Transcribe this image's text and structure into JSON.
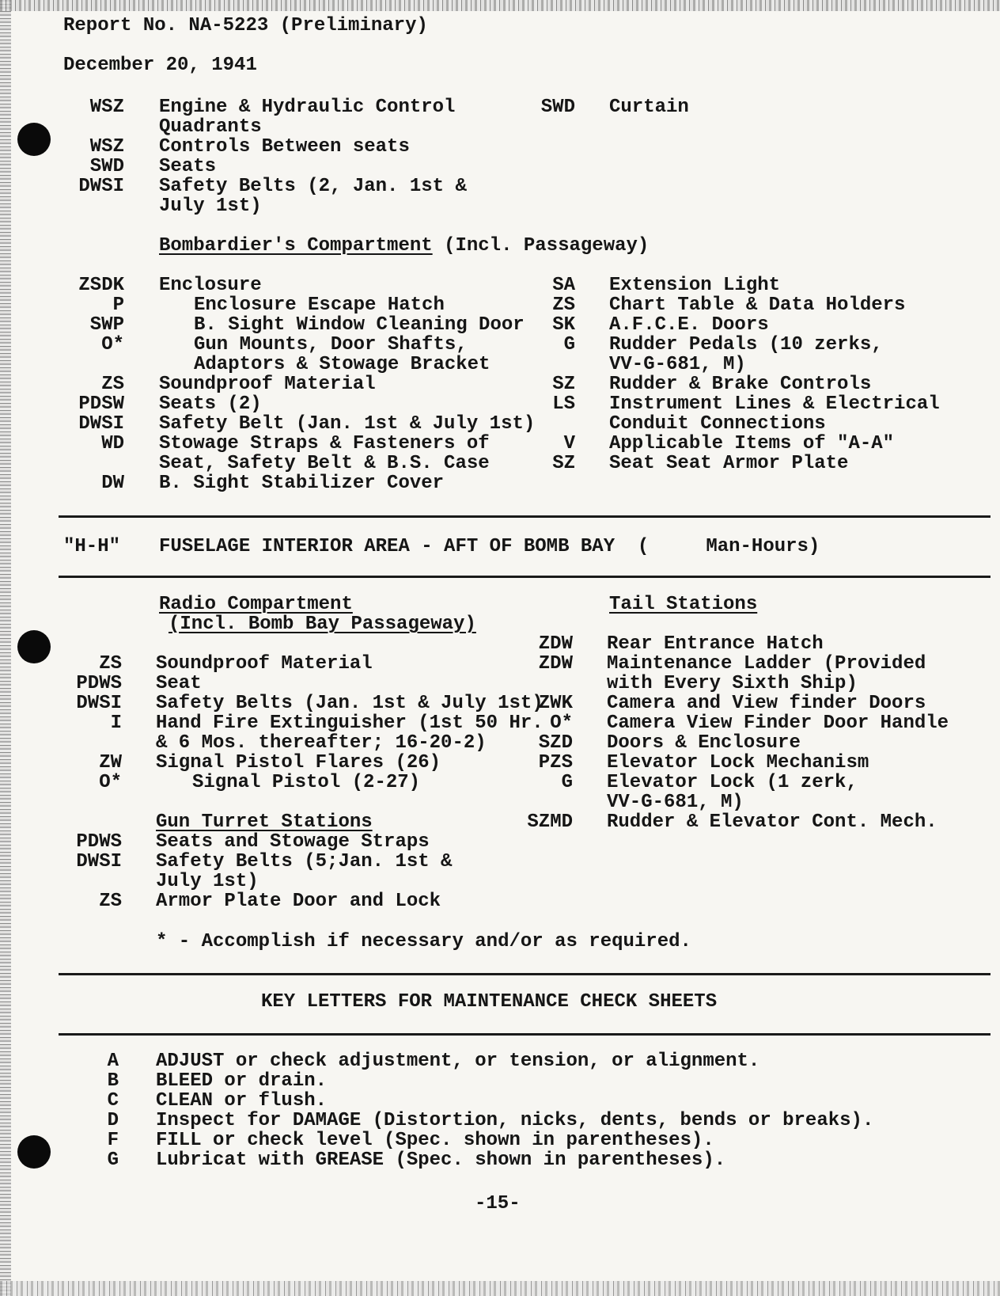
{
  "header": {
    "report_no": "Report No. NA-5223 (Preliminary)",
    "date": "December 20, 1941"
  },
  "pilot_items_left": [
    {
      "code": "WSZ",
      "lines": [
        "Engine & Hydraulic Control",
        "Quadrants"
      ]
    },
    {
      "code": "WSZ",
      "lines": [
        "Controls Between seats"
      ]
    },
    {
      "code": "SWD",
      "lines": [
        "Seats"
      ]
    },
    {
      "code": "DWSI",
      "lines": [
        "Safety Belts (2, Jan. 1st &",
        "July 1st)"
      ]
    }
  ],
  "pilot_items_right": [
    {
      "code": "SWD",
      "lines": [
        "Curtain"
      ]
    }
  ],
  "bombardier": {
    "title": "Bombardier's Compartment",
    "subtitle": "(Incl. Passageway)",
    "left": [
      {
        "code": "ZSDK",
        "text": "Enclosure",
        "indent": false
      },
      {
        "code": "P",
        "text": "Enclosure Escape Hatch",
        "indent": true
      },
      {
        "code": "SWP",
        "text": "B. Sight Window Cleaning Door",
        "indent": true
      },
      {
        "code": "O*",
        "text": "Gun Mounts, Door Shafts,",
        "indent": true
      },
      {
        "code": "",
        "text": "Adaptors & Stowage Bracket",
        "indent": true
      },
      {
        "code": "ZS",
        "text": "Soundproof Material",
        "indent": false
      },
      {
        "code": "PDSW",
        "text": "Seats (2)",
        "indent": false
      },
      {
        "code": "DWSI",
        "text": "Safety Belt (Jan. 1st & July 1st)",
        "indent": false
      },
      {
        "code": "WD",
        "text": "Stowage Straps & Fasteners of",
        "indent": false
      },
      {
        "code": "",
        "text": "Seat, Safety Belt & B.S. Case",
        "indent": false
      },
      {
        "code": "DW",
        "text": "B. Sight Stabilizer Cover",
        "indent": false
      }
    ],
    "right": [
      {
        "code": "SA",
        "text": "Extension Light"
      },
      {
        "code": "ZS",
        "text": "Chart Table & Data Holders"
      },
      {
        "code": "SK",
        "text": "A.F.C.E. Doors"
      },
      {
        "code": "G",
        "text": "Rudder Pedals (10 zerks,"
      },
      {
        "code": "",
        "text": "VV-G-681, M)"
      },
      {
        "code": "SZ",
        "text": "Rudder & Brake Controls"
      },
      {
        "code": "LS",
        "text": "Instrument Lines & Electrical"
      },
      {
        "code": "",
        "text": "Conduit Connections"
      },
      {
        "code": "V",
        "text": "Applicable Items of \"A-A\""
      },
      {
        "code": "SZ",
        "text": "Seat Seat Armor Plate"
      }
    ]
  },
  "section_hh": {
    "code": "\"H-H\"",
    "title": "FUSELAGE INTERIOR AREA - AFT OF BOMB BAY  (     Man-Hours)"
  },
  "radio": {
    "title": "Radio Compartment",
    "subtitle": "(Incl. Bomb Bay Passageway)",
    "items": [
      {
        "code": "ZS",
        "text": "Soundproof Material",
        "indent": false
      },
      {
        "code": "PDWS",
        "text": "Seat",
        "indent": false
      },
      {
        "code": "DWSI",
        "text": "Safety Belts (Jan. 1st & July 1st)",
        "indent": false
      },
      {
        "code": "I",
        "text": "Hand Fire Extinguisher (1st 50 Hr.",
        "indent": false
      },
      {
        "code": "",
        "text": "& 6 Mos. thereafter; 16-20-2)",
        "indent": false
      },
      {
        "code": "ZW",
        "text": "Signal Pistol Flares (26)",
        "indent": false
      },
      {
        "code": "O*",
        "text": "Signal Pistol (2-27)",
        "indent": true
      }
    ]
  },
  "gun_turret": {
    "title": "Gun Turret Stations",
    "items": [
      {
        "code": "PDWS",
        "text": "Seats and Stowage Straps"
      },
      {
        "code": "DWSI",
        "text": "Safety Belts (5;Jan. 1st &"
      },
      {
        "code": "",
        "text": "July 1st)"
      },
      {
        "code": "ZS",
        "text": "Armor Plate Door and Lock"
      }
    ]
  },
  "tail": {
    "title": "Tail Stations",
    "items": [
      {
        "code": "ZDW",
        "text": "Rear Entrance Hatch"
      },
      {
        "code": "ZDW",
        "text": "Maintenance Ladder (Provided"
      },
      {
        "code": "",
        "text": "with Every Sixth Ship)"
      },
      {
        "code": "ZWK",
        "text": "Camera and View finder Doors"
      },
      {
        "code": "O*",
        "text": "Camera View Finder Door Handle"
      },
      {
        "code": "SZD",
        "text": "Doors & Enclosure"
      },
      {
        "code": "PZS",
        "text": "Elevator Lock Mechanism"
      },
      {
        "code": "G",
        "text": "Elevator Lock (1 zerk,"
      },
      {
        "code": "",
        "text": "VV-G-681, M)"
      },
      {
        "code": "SZMD",
        "text": "Rudder & Elevator Cont. Mech."
      }
    ]
  },
  "footnote": "* - Accomplish if necessary and/or as required.",
  "key_letters": {
    "title": "KEY LETTERS FOR MAINTENANCE CHECK SHEETS",
    "items": [
      {
        "letter": "A",
        "text": "ADJUST or check adjustment, or tension, or alignment."
      },
      {
        "letter": "B",
        "text": "BLEED or drain."
      },
      {
        "letter": "C",
        "text": "CLEAN or flush."
      },
      {
        "letter": "D",
        "text": "Inspect for DAMAGE (Distortion, nicks, dents, bends or breaks)."
      },
      {
        "letter": "F",
        "text": "FILL or check level (Spec. shown in parentheses)."
      },
      {
        "letter": "G",
        "text": "Lubricat with GREASE (Spec. shown in parentheses)."
      }
    ]
  },
  "page_number": "-15-"
}
